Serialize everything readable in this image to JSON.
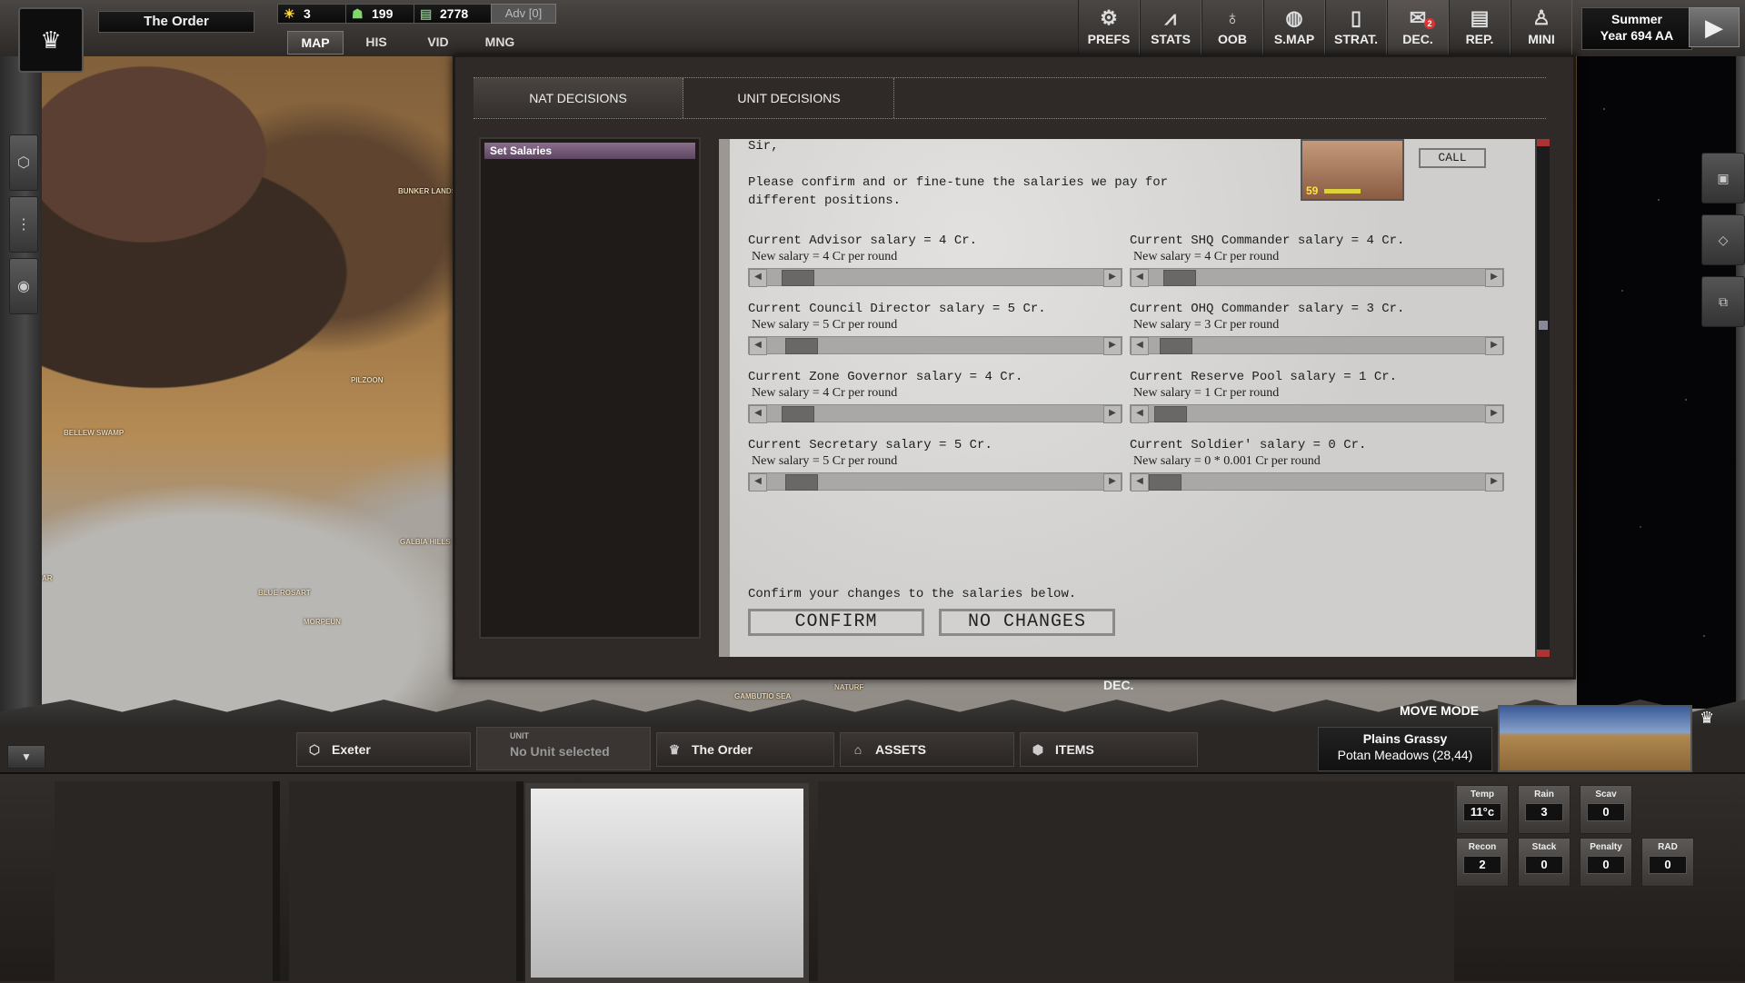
{
  "header": {
    "faction_name": "The Order",
    "resources": [
      {
        "icon": "sun-icon",
        "value": "3"
      },
      {
        "icon": "people-icon",
        "value": "199"
      },
      {
        "icon": "credits-icon",
        "value": "2778"
      }
    ],
    "adv_label": "Adv [0]",
    "tabs": [
      "MAP",
      "HIS",
      "VID",
      "MNG"
    ],
    "nav": [
      {
        "icon": "gear-icon",
        "label": "PREFS"
      },
      {
        "icon": "chart-icon",
        "label": "STATS"
      },
      {
        "icon": "hierarchy-icon",
        "label": "OOB"
      },
      {
        "icon": "globe-icon",
        "label": "S.MAP"
      },
      {
        "icon": "strategy-card-icon",
        "label": "STRAT."
      },
      {
        "icon": "envelope-icon",
        "label": "DEC.",
        "badge": "2"
      },
      {
        "icon": "report-icon",
        "label": "REP."
      },
      {
        "icon": "user-icon",
        "label": "MINI"
      }
    ],
    "season": "Summer",
    "year": "Year 694 AA"
  },
  "map_labels": [
    "Bunker Lands",
    "Pilzoon",
    "Bellew Swamp",
    "Galbia Hills",
    "Haetgar",
    "Blue Rosart",
    "Morpeun",
    "Gambutio Sea",
    "Naturf"
  ],
  "decisions": {
    "tabs": [
      "NAT DECISIONS",
      "UNIT DECISIONS"
    ],
    "list": [
      "Set Salaries"
    ],
    "letter": {
      "greeting": "Sir,",
      "intro": "Please confirm and or fine-tune the salaries we pay for different positions.",
      "portrait_level": "59",
      "call_label": "CALL",
      "salaries": [
        {
          "current": "Current Advisor salary = 4 Cr.",
          "new": "New salary = 4 Cr per round",
          "level": 0.08
        },
        {
          "current": "Current SHQ Commander salary = 4 Cr.",
          "new": "New salary = 4 Cr per round",
          "level": 0.08
        },
        {
          "current": "Current Council Director salary = 5 Cr.",
          "new": "New salary = 5 Cr per round",
          "level": 0.1
        },
        {
          "current": "Current OHQ Commander salary = 3 Cr.",
          "new": "New salary = 3 Cr per round",
          "level": 0.06
        },
        {
          "current": "Current Zone Governor salary = 4 Cr.",
          "new": "New salary = 4 Cr per round",
          "level": 0.08
        },
        {
          "current": "Current Reserve Pool salary = 1 Cr.",
          "new": "New salary = 1 Cr per round",
          "level": 0.02
        },
        {
          "current": "Current Secretary salary = 5 Cr.",
          "new": "New salary = 5 Cr per round",
          "level": 0.1
        },
        {
          "current": "Current Soldier' salary = 0 Cr.",
          "new": "New salary = 0 * 0.001 Cr per round",
          "level": 0.0
        }
      ],
      "confirm_text": "Confirm your changes to the salaries below.",
      "confirm_label": "CONFIRM",
      "no_changes_label": "NO CHANGES"
    }
  },
  "map_captions": {
    "dec": "DEC.",
    "move_mode": "MOVE MODE"
  },
  "bottom": {
    "tabs": [
      {
        "icon": "hex-icon",
        "label": "Exeter"
      },
      {
        "icon": "crown-icon",
        "label": "The Order"
      },
      {
        "icon": "bank-icon",
        "label": "ASSETS"
      },
      {
        "icon": "box-icon",
        "label": "ITEMS"
      }
    ],
    "unit_label": "UNIT",
    "unit_value": "No Unit selected",
    "terrain_type": "Plains Grassy",
    "terrain_location": "Potan Meadows (28,44)",
    "stats": [
      {
        "label": "Temp",
        "value": "11°c"
      },
      {
        "label": "Rain",
        "value": "3"
      },
      {
        "label": "Scav",
        "value": "0"
      },
      {
        "label": "Recon",
        "value": "2"
      },
      {
        "label": "Stack",
        "value": "0"
      },
      {
        "label": "Penalty",
        "value": "0"
      },
      {
        "label": "RAD",
        "value": "0"
      }
    ]
  }
}
